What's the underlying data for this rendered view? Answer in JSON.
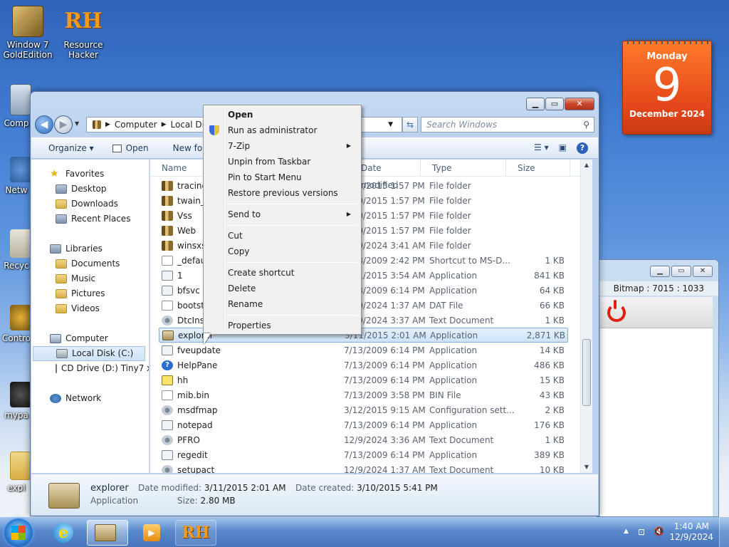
{
  "desktop": {
    "icons": [
      {
        "label": "Window 7 GoldEdition"
      },
      {
        "label": "Resource Hacker"
      },
      {
        "label": "Comp"
      },
      {
        "label": "Netw"
      },
      {
        "label": "Recyc"
      },
      {
        "label": "Contro"
      },
      {
        "label": "mypa"
      },
      {
        "label": "expl"
      }
    ]
  },
  "calendar": {
    "weekday": "Monday",
    "day": "9",
    "month_year": "December 2024"
  },
  "bg_window": {
    "info": "Bitmap : 7015 : 1033"
  },
  "explorer": {
    "address": {
      "parts": [
        "Computer",
        "Local Disk"
      ]
    },
    "search_placeholder": "Search Windows",
    "commands": {
      "organize": "Organize",
      "open": "Open",
      "new_folder": "New fold"
    },
    "nav": {
      "favorites": "Favorites",
      "desktop": "Desktop",
      "downloads": "Downloads",
      "recent": "Recent Places",
      "libraries": "Libraries",
      "documents": "Documents",
      "music": "Music",
      "pictures": "Pictures",
      "videos": "Videos",
      "computer": "Computer",
      "local_disk": "Local Disk (C:)",
      "cd_drive": "CD Drive (D:) Tiny7 x",
      "network": "Network"
    },
    "columns": {
      "name": "Name",
      "date": "Date modified",
      "type": "Type",
      "size": "Size"
    },
    "files": [
      {
        "name": "tracing",
        "date": "7/13/2015 1:57 PM",
        "type": "File folder",
        "size": "",
        "icon": "folder"
      },
      {
        "name": "twain_32",
        "date": "3/10/2015 1:57 PM",
        "type": "File folder",
        "size": "",
        "icon": "folder"
      },
      {
        "name": "Vss",
        "date": "3/10/2015 1:57 PM",
        "type": "File folder",
        "size": "",
        "icon": "folder"
      },
      {
        "name": "Web",
        "date": "3/10/2015 1:57 PM",
        "type": "File folder",
        "size": "",
        "icon": "folder"
      },
      {
        "name": "winsxs",
        "date": "12/9/2024 3:41 AM",
        "type": "File folder",
        "size": "",
        "icon": "folder"
      },
      {
        "name": "_default",
        "date": "7/13/2009 2:42 PM",
        "type": "Shortcut to MS-D...",
        "size": "1 KB",
        "icon": "doc"
      },
      {
        "name": "1",
        "date": "3/11/2015 3:54 AM",
        "type": "Application",
        "size": "841 KB",
        "icon": "app"
      },
      {
        "name": "bfsvc",
        "date": "7/13/2009 6:14 PM",
        "type": "Application",
        "size": "64 KB",
        "icon": "app"
      },
      {
        "name": "bootstat",
        "date": "12/9/2024 1:37 AM",
        "type": "DAT File",
        "size": "66 KB",
        "icon": "doc"
      },
      {
        "name": "DtcInstall",
        "date": "12/9/2024 3:37 AM",
        "type": "Text Document",
        "size": "1 KB",
        "icon": "gear"
      },
      {
        "name": "explorer",
        "date": "3/11/2015 2:01 AM",
        "type": "Application",
        "size": "2,871 KB",
        "icon": "explorer",
        "selected": true
      },
      {
        "name": "fveupdate",
        "date": "7/13/2009 6:14 PM",
        "type": "Application",
        "size": "14 KB",
        "icon": "app"
      },
      {
        "name": "HelpPane",
        "date": "7/13/2009 6:14 PM",
        "type": "Application",
        "size": "486 KB",
        "icon": "help"
      },
      {
        "name": "hh",
        "date": "7/13/2009 6:14 PM",
        "type": "Application",
        "size": "15 KB",
        "icon": "hh"
      },
      {
        "name": "mib.bin",
        "date": "7/13/2009 3:58 PM",
        "type": "BIN File",
        "size": "43 KB",
        "icon": "doc"
      },
      {
        "name": "msdfmap",
        "date": "3/12/2015 9:15 AM",
        "type": "Configuration sett...",
        "size": "2 KB",
        "icon": "gear"
      },
      {
        "name": "notepad",
        "date": "7/13/2009 6:14 PM",
        "type": "Application",
        "size": "176 KB",
        "icon": "app"
      },
      {
        "name": "PFRO",
        "date": "12/9/2024 3:36 AM",
        "type": "Text Document",
        "size": "1 KB",
        "icon": "gear"
      },
      {
        "name": "regedit",
        "date": "7/13/2009 6:14 PM",
        "type": "Application",
        "size": "389 KB",
        "icon": "app"
      },
      {
        "name": "setupact",
        "date": "12/9/2024 1:37 AM",
        "type": "Text Document",
        "size": "10 KB",
        "icon": "gear"
      }
    ],
    "details": {
      "name": "explorer",
      "type": "Application",
      "date_modified_label": "Date modified:",
      "date_modified": "3/11/2015 2:01 AM",
      "size_label": "Size:",
      "size": "2.80 MB",
      "date_created_label": "Date created:",
      "date_created": "3/10/2015 5:41 PM"
    }
  },
  "context_menu": {
    "items": [
      "Open",
      "Run as administrator",
      "7-Zip",
      "Unpin from Taskbar",
      "Pin to Start Menu",
      "Restore previous versions",
      "Send to",
      "Cut",
      "Copy",
      "Create shortcut",
      "Delete",
      "Rename",
      "Properties"
    ]
  },
  "taskbar": {
    "rh_label": "RH",
    "time": "1:40 AM",
    "date": "12/9/2024"
  }
}
